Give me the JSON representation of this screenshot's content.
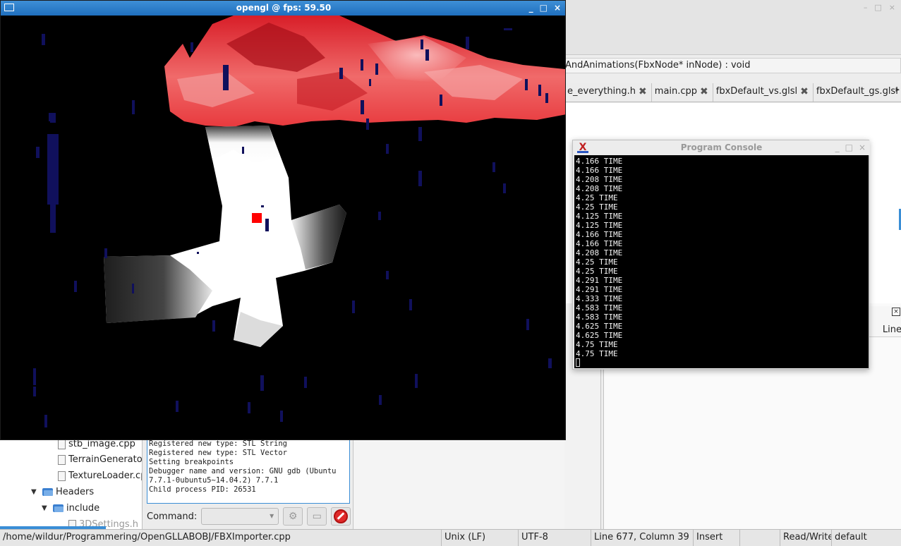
{
  "ide": {
    "window_controls": [
      "–",
      "□",
      "×"
    ],
    "signature": "AndAnimations(FbxNode* inNode) : void",
    "tabs": [
      {
        "label": "e_everything.h"
      },
      {
        "label": "main.cpp"
      },
      {
        "label": "fbxDefault_vs.glsl"
      },
      {
        "label": "fbxDefault_gs.glsl"
      }
    ],
    "tab_scroll_arrow": "▸",
    "lower_panel_close": "×",
    "lower_panel_column_header": "Line"
  },
  "project_tree": {
    "items": [
      {
        "label": "stb_image.cpp",
        "kind": "file"
      },
      {
        "label": "TerrainGenerator.cpp",
        "kind": "file"
      },
      {
        "label": "TextureLoader.cpp",
        "kind": "file"
      },
      {
        "label": "Headers",
        "kind": "folder",
        "expanded": true
      },
      {
        "label": "include",
        "kind": "folder",
        "expanded": true
      },
      {
        "label": "3DSettings.h",
        "kind": "file"
      }
    ]
  },
  "debugger": {
    "log": "Registered new type: STL String\nRegistered new type: STL Vector\nSetting breakpoints\nDebugger name and version: GNU gdb (Ubuntu\n7.7.1-0ubuntu5~14.04.2) 7.7.1\nChild process PID: 26531",
    "command_label": "Command:",
    "command_value": ""
  },
  "statusbar": {
    "path": "/home/wildur/Programmering/OpenGLLABOBJ/FBXImporter.cpp",
    "line_endings": "Unix (LF)",
    "encoding": "UTF-8",
    "position": "Line 677, Column 39",
    "mode": "Insert",
    "blank": "",
    "access": "Read/Write",
    "lexer": "default"
  },
  "gl_window": {
    "title": "opengl @ fps: 59.50",
    "controls": [
      "_",
      "□",
      "×"
    ]
  },
  "console": {
    "title": "Program Console",
    "icon_letter": "X",
    "controls": [
      "_",
      "□",
      "×"
    ],
    "lines": [
      "4.166 TIME",
      "4.166 TIME",
      "4.208 TIME",
      "4.208 TIME",
      "4.25 TIME",
      "4.25 TIME",
      "4.125 TIME",
      "4.125 TIME",
      "4.166 TIME",
      "4.166 TIME",
      "4.208 TIME",
      "4.25 TIME",
      "4.25 TIME",
      "4.291 TIME",
      "4.291 TIME",
      "4.333 TIME",
      "4.583 TIME",
      "4.583 TIME",
      "4.625 TIME",
      "4.625 TIME",
      "4.75 TIME",
      "4.75 TIME"
    ]
  },
  "colors": {
    "titlebar_blue": "#2a7cc8",
    "terrain_red": "#e8343a",
    "model_white": "#ffffff",
    "particle_blue": "#10105c",
    "marker_red": "#ff0000"
  }
}
